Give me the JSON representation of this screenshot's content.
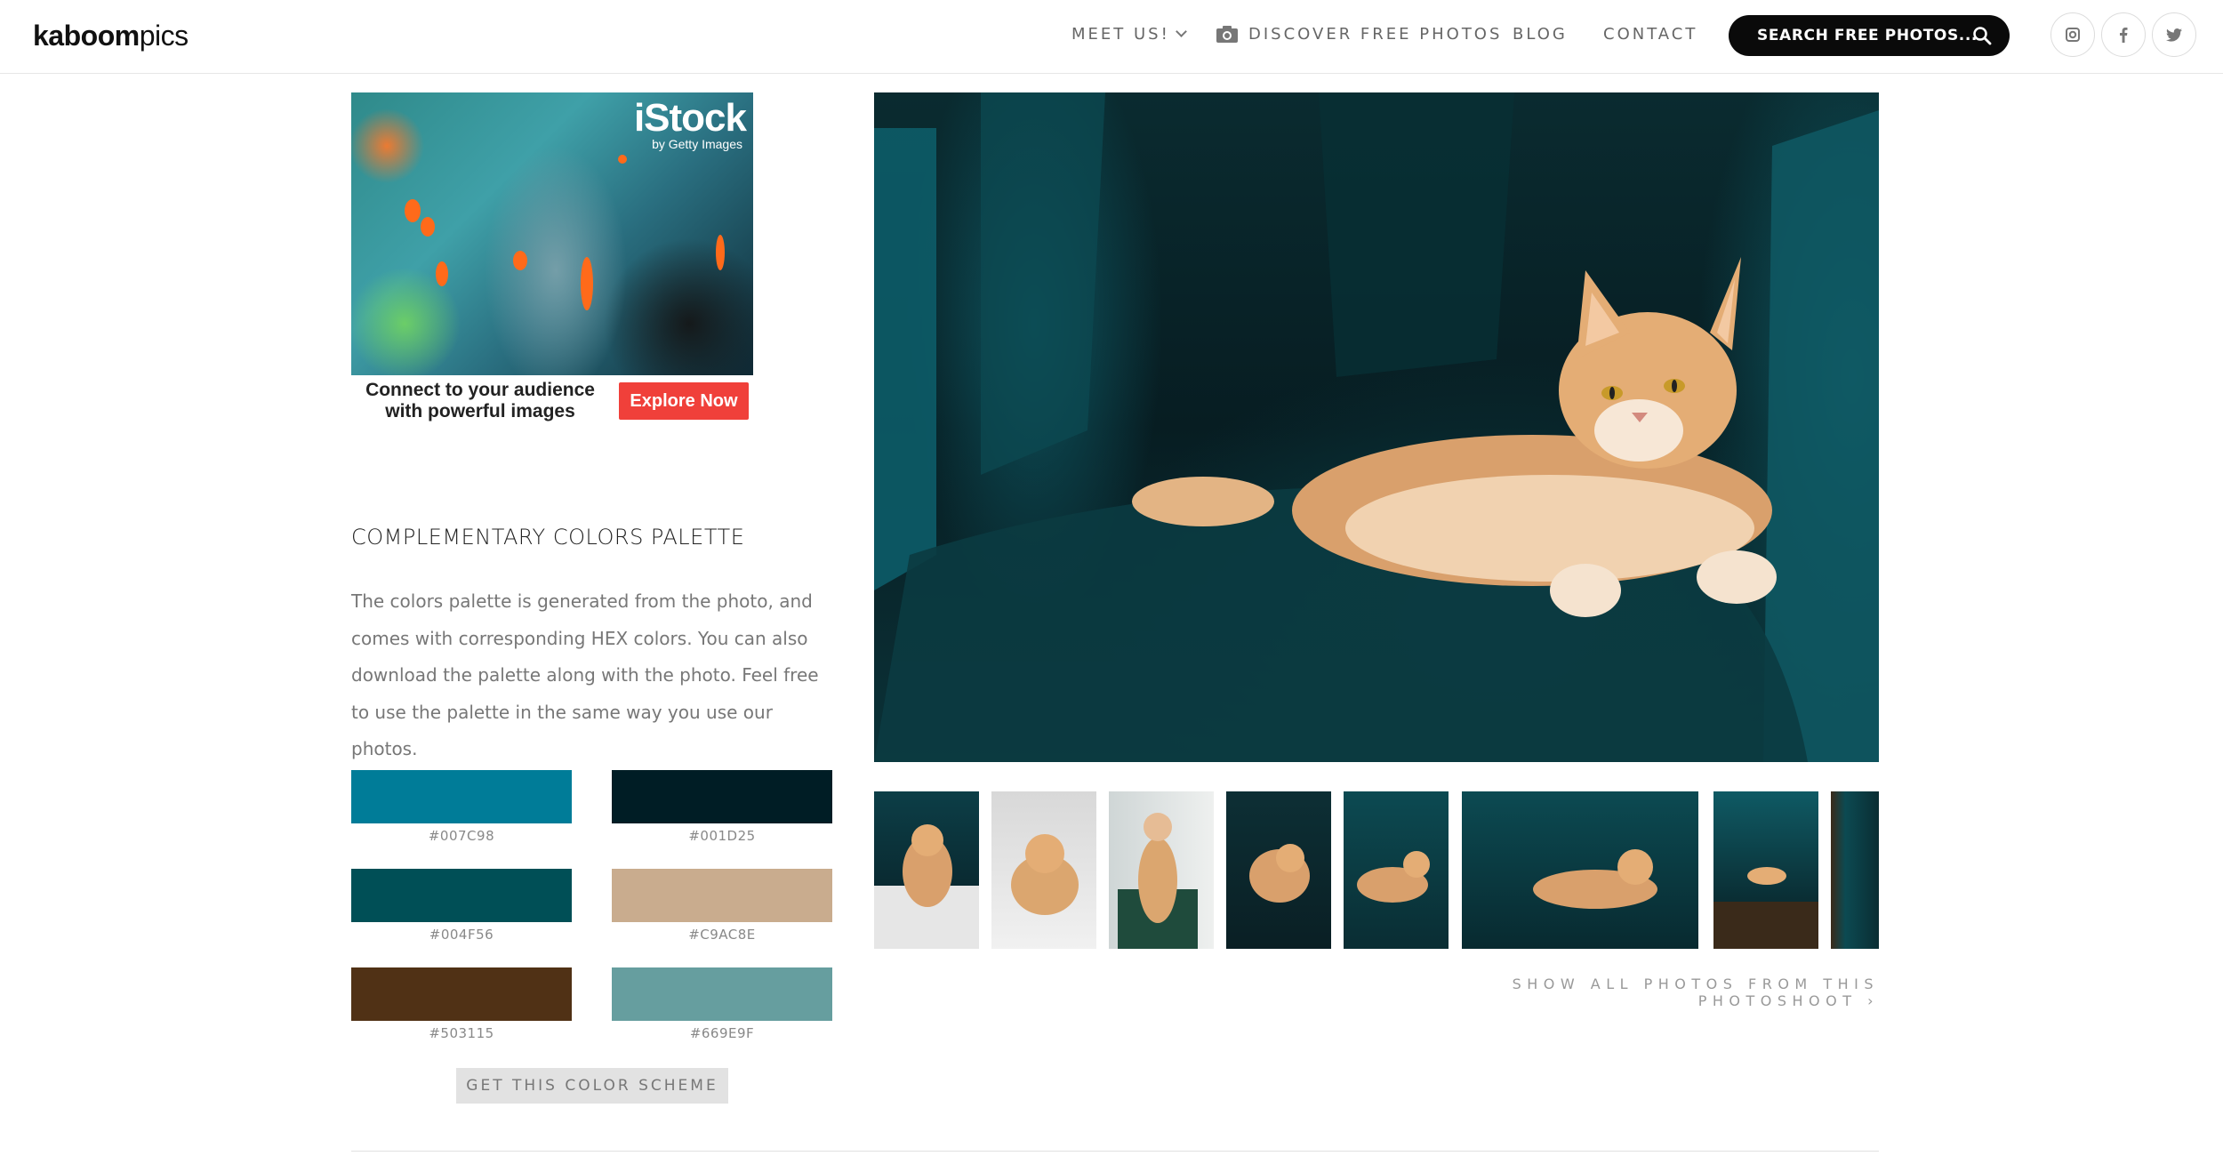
{
  "header": {
    "logo_bold": "kaboom",
    "logo_light": "pics",
    "nav": {
      "meet": "MEET US!",
      "discover": "DISCOVER FREE PHOTOS",
      "blog": "BLOG",
      "contact": "CONTACT"
    },
    "search_label": "SEARCH FREE PHOTOS...",
    "social": [
      "instagram-icon",
      "facebook-icon",
      "twitter-icon"
    ]
  },
  "ad": {
    "brand": "iStock",
    "brand_sub": "by Getty Images",
    "tagline": "Connect to your audience with powerful images",
    "cta": "Explore Now"
  },
  "palette": {
    "title": "COMPLEMENTARY COLORS PALETTE",
    "description": "The colors palette is generated from the photo, and comes with corresponding HEX colors. You can also download the palette along with the photo. Feel free to use the palette in the same way you use our photos.",
    "colors": [
      {
        "hex": "#007C98",
        "label": "#007C98"
      },
      {
        "hex": "#001D25",
        "label": "#001D25"
      },
      {
        "hex": "#004F56",
        "label": "#004F56"
      },
      {
        "hex": "#C9AC8E",
        "label": "#C9AC8E"
      },
      {
        "hex": "#503115",
        "label": "#503115"
      },
      {
        "hex": "#669E9F",
        "label": "#669E9F"
      }
    ],
    "button": "GET THIS COLOR SCHEME"
  },
  "gallery": {
    "show_all": "SHOW ALL PHOTOS FROM THIS PHOTOSHOOT ›"
  }
}
